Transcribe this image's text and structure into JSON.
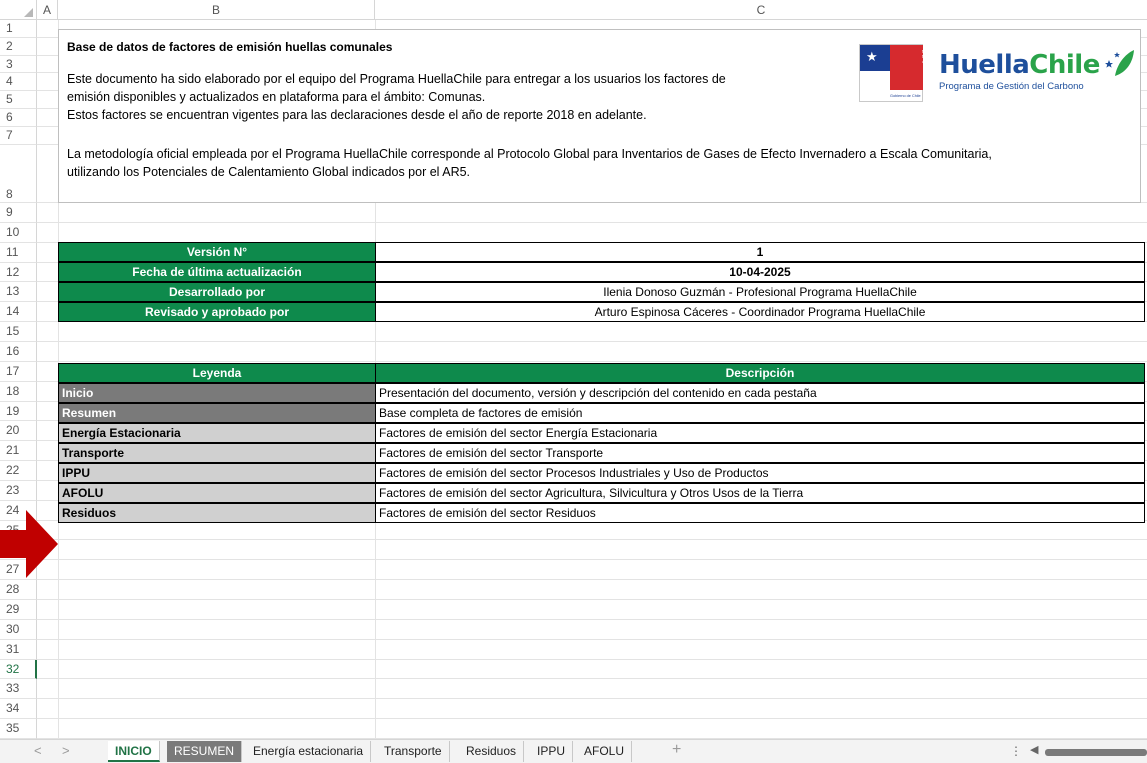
{
  "columns": [
    "A",
    "B",
    "C"
  ],
  "rows": [
    "1",
    "2",
    "3",
    "4",
    "5",
    "6",
    "7",
    "8",
    "9",
    "10",
    "11",
    "12",
    "13",
    "14",
    "15",
    "16",
    "17",
    "18",
    "19",
    "20",
    "21",
    "22",
    "23",
    "24",
    "25",
    "26",
    "27",
    "28",
    "29",
    "30",
    "31",
    "32",
    "33",
    "34",
    "35"
  ],
  "active_row": "32",
  "intro": {
    "title": "Base de datos de factores de emisión huellas comunales",
    "line1": "Este documento ha sido elaborado por el equipo del Programa HuellaChile para entregar a los usuarios los factores de",
    "line2": "emisión disponibles y actualizados en plataforma para el ámbito: Comunas.",
    "line3": "Estos factores se encuentran vigentes para las declaraciones desde el año de reporte 2018 en adelante.",
    "line4": "La metodología oficial empleada por el Programa HuellaChile corresponde al Protocolo Global para Inventarios de Gases de Efecto Invernadero a Escala Comunitaria,",
    "line5": "utilizando los Potenciales de Calentamiento Global indicados por el AR5."
  },
  "logo": {
    "ministry_text": "Ministerio del Medio Ambiente",
    "gov_text": "Gobierno de Chile",
    "brand_a": "Huella",
    "brand_b": "Chile",
    "brand_sub": "Programa de Gestión del Carbono"
  },
  "version_table": [
    {
      "label": "Versión N°",
      "value": "1",
      "bold": true
    },
    {
      "label": "Fecha de última actualización",
      "value": "10-04-2025",
      "bold": true
    },
    {
      "label": "Desarrollado por",
      "value": "Ilenia Donoso Guzmán - Profesional Programa HuellaChile",
      "bold": false
    },
    {
      "label": "Revisado y aprobado por",
      "value": "Arturo Espinosa Cáceres - Coordinador Programa HuellaChile",
      "bold": false
    }
  ],
  "legend_table": {
    "header_legend": "Leyenda",
    "header_desc": "Descripción",
    "rows": [
      {
        "name": "Inicio",
        "desc": "Presentación del documento, versión y descripción del contenido en cada pestaña",
        "style": "dark"
      },
      {
        "name": "Resumen",
        "desc": "Base completa de factores de emisión",
        "style": "dark"
      },
      {
        "name": "Energía Estacionaria",
        "desc": "Factores de emisión del sector Energía Estacionaria",
        "style": "light"
      },
      {
        "name": "Transporte",
        "desc": "Factores de emisión del sector Transporte",
        "style": "light"
      },
      {
        "name": "IPPU",
        "desc": "Factores de emisión del sector Procesos Industriales y Uso de Productos",
        "style": "light"
      },
      {
        "name": "AFOLU",
        "desc": "Factores de emisión del sector Agricultura, Silvicultura y Otros Usos de la Tierra",
        "style": "light"
      },
      {
        "name": "Residuos",
        "desc": "Factores de emisión del sector Residuos",
        "style": "light"
      }
    ]
  },
  "sheet_tabs": [
    {
      "label": "INICIO",
      "state": "active"
    },
    {
      "label": "RESUMEN",
      "state": "gray"
    },
    {
      "label": "Energía estacionaria",
      "state": "normal"
    },
    {
      "label": "Transporte",
      "state": "normal"
    },
    {
      "label": "Residuos",
      "state": "normal"
    },
    {
      "label": "IPPU",
      "state": "normal"
    },
    {
      "label": "AFOLU",
      "state": "normal"
    }
  ],
  "nav": {
    "prev": "<",
    "next": ">",
    "add": "+",
    "more": "⋮",
    "scroll_left": "◀"
  },
  "colors": {
    "green": "#0e8a4c",
    "dark_gray": "#7a7a7a",
    "light_gray": "#d0d0d0",
    "excel_green": "#217346",
    "arrow_red": "#c00000"
  }
}
